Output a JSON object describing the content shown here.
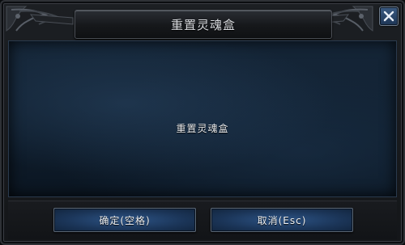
{
  "dialog": {
    "title": "重置灵魂盒",
    "message": "重置灵魂盒",
    "close_icon": "close-icon",
    "ornament_icon": "gothic-corner-ornament"
  },
  "buttons": {
    "confirm_label": "确定(空格)",
    "cancel_label": "取消(Esc)"
  },
  "colors": {
    "panel_blue": "#152638",
    "button_blue": "#2d5486",
    "close_button_blue": "#3b5b82"
  }
}
